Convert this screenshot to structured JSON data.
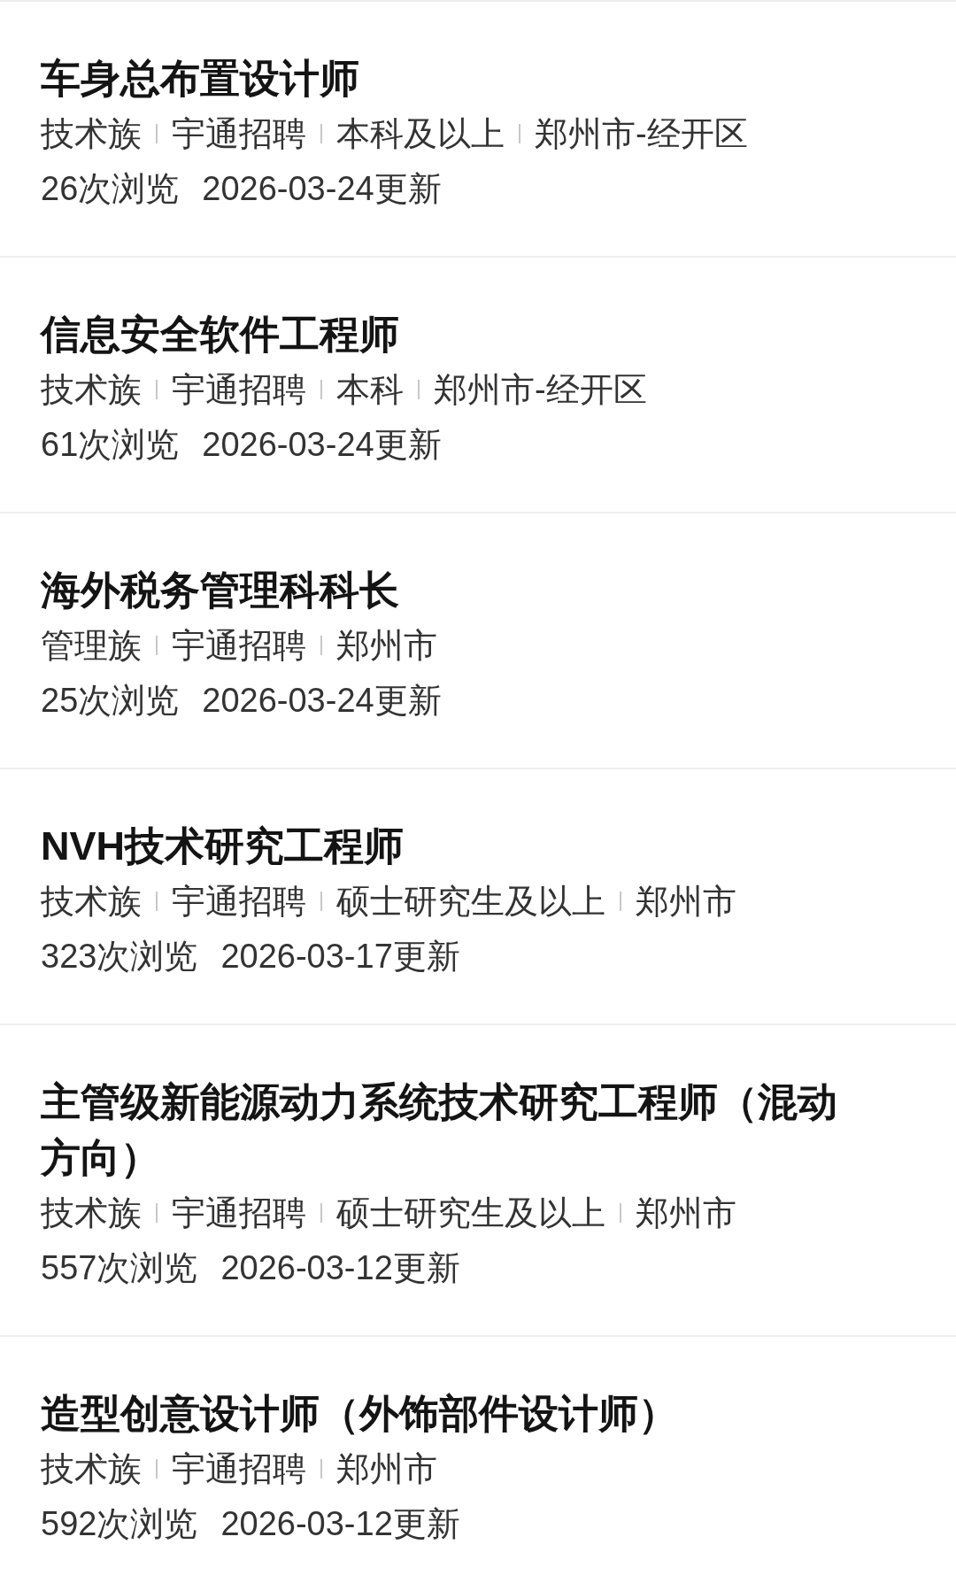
{
  "jobs": [
    {
      "title": "车身总布置设计师",
      "tags": [
        "技术族",
        "宇通招聘",
        "本科及以上",
        "郑州市-经开区"
      ],
      "views": "26次浏览",
      "updated": "2026-03-24更新"
    },
    {
      "title": "信息安全软件工程师",
      "tags": [
        "技术族",
        "宇通招聘",
        "本科",
        "郑州市-经开区"
      ],
      "views": "61次浏览",
      "updated": "2026-03-24更新"
    },
    {
      "title": "海外税务管理科科长",
      "tags": [
        "管理族",
        "宇通招聘",
        "郑州市"
      ],
      "views": "25次浏览",
      "updated": "2026-03-24更新"
    },
    {
      "title": "NVH技术研究工程师",
      "tags": [
        "技术族",
        "宇通招聘",
        "硕士研究生及以上",
        "郑州市"
      ],
      "views": "323次浏览",
      "updated": "2026-03-17更新"
    },
    {
      "title": "主管级新能源动力系统技术研究工程师（混动方向）",
      "tags": [
        "技术族",
        "宇通招聘",
        "硕士研究生及以上",
        "郑州市"
      ],
      "views": "557次浏览",
      "updated": "2026-03-12更新"
    },
    {
      "title": "造型创意设计师（外饰部件设计师）",
      "tags": [
        "技术族",
        "宇通招聘",
        "郑州市"
      ],
      "views": "592次浏览",
      "updated": "2026-03-12更新"
    }
  ]
}
